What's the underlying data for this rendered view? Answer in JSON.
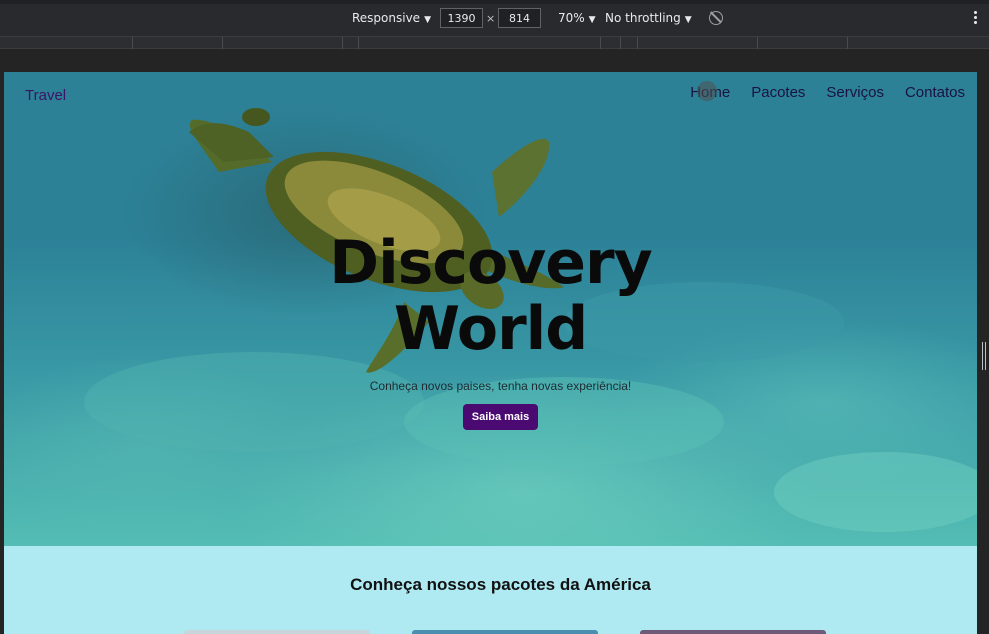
{
  "devtools": {
    "device_mode": "Responsive",
    "width": "1390",
    "height": "814",
    "times": "×",
    "zoom": "70%",
    "throttling": "No throttling"
  },
  "page": {
    "brand": "Travel",
    "nav": [
      "Home",
      "Pacotes",
      "Serviços",
      "Contatos"
    ],
    "hero": {
      "title_line1": "Discovery",
      "title_line2": "World",
      "subtitle": "Conheça novos paises, tenha novas experiência!",
      "cta_label": "Saiba mais"
    },
    "section_title": "Conheça nossos pacotes da América"
  },
  "colors": {
    "brand": "#3c1466",
    "cta": "#4a0a72",
    "section_bg": "#afeaf3",
    "water": "#2d8196"
  }
}
